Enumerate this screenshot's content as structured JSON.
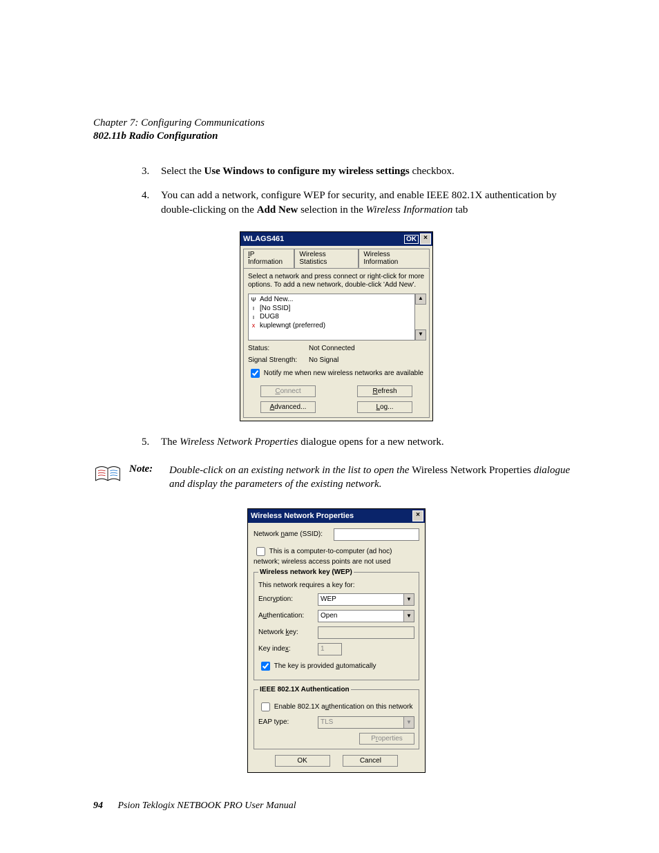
{
  "header": {
    "chapter": "Chapter 7:  Configuring Communications",
    "section": "802.11b Radio Configuration"
  },
  "steps": {
    "s3": {
      "num": "3.",
      "pre": "Select the ",
      "bold": "Use Windows to configure my wireless settings",
      "post": " checkbox."
    },
    "s4": {
      "num": "4.",
      "pre": "You can add a network, configure WEP for security, and enable IEEE 802.1X authentication by double-clicking on the ",
      "bold": "Add New",
      "mid": " selection in the ",
      "ital": "Wireless Information",
      "post": " tab"
    },
    "s5": {
      "num": "5.",
      "pre": "The ",
      "ital": "Wireless Network Properties",
      "post": " dialogue opens for a new network."
    }
  },
  "note": {
    "label": "Note:",
    "pre": "Double-click on an existing network in the list to open the ",
    "upright": "Wireless Network Properties",
    "post": " dialogue and display the parameters of the existing network."
  },
  "win1": {
    "title": "WLAGS461",
    "ok": "OK",
    "close": "×",
    "tabs": {
      "t1": "IP Information",
      "t2": "Wireless Statistics",
      "t3": "Wireless Information"
    },
    "instr": "Select a network and press connect or right-click for more options.  To add a new network, double-click 'Add New'.",
    "list": {
      "i0": "Add New...",
      "i1": "[No SSID]",
      "i2": "DUG8",
      "i3": "kuplewngt (preferred)"
    },
    "status_label": "Status:",
    "status_value": "Not Connected",
    "signal_label": "Signal Strength:",
    "signal_value": "No Signal",
    "notify": "Notify me when new wireless networks are available",
    "connect": "Connect",
    "refresh": "Refresh",
    "advanced": "Advanced...",
    "log": "Log..."
  },
  "win2": {
    "title": "Wireless Network Properties",
    "close": "×",
    "ssid_label": "Network name (SSID):",
    "adhoc": "This is a computer-to-computer (ad hoc) network; wireless access points are not used",
    "wep_legend": "Wireless network key (WEP)",
    "wep_sub": "This network requires a key for:",
    "enc_label": "Encryption:",
    "enc_value": "WEP",
    "auth_label": "Authentication:",
    "auth_value": "Open",
    "netkey_label": "Network key:",
    "keyidx_label": "Key index:",
    "keyidx_value": "1",
    "autokey": "The key is provided automatically",
    "ieee_legend": "IEEE 802.1X Authentication",
    "enable8021x": "Enable 802.1X authentication on this network",
    "eap_label": "EAP type:",
    "eap_value": "TLS",
    "properties": "Properties",
    "ok": "OK",
    "cancel": "Cancel"
  },
  "footer": {
    "page": "94",
    "text": "Psion Teklogix NETBOOK PRO User Manual"
  }
}
